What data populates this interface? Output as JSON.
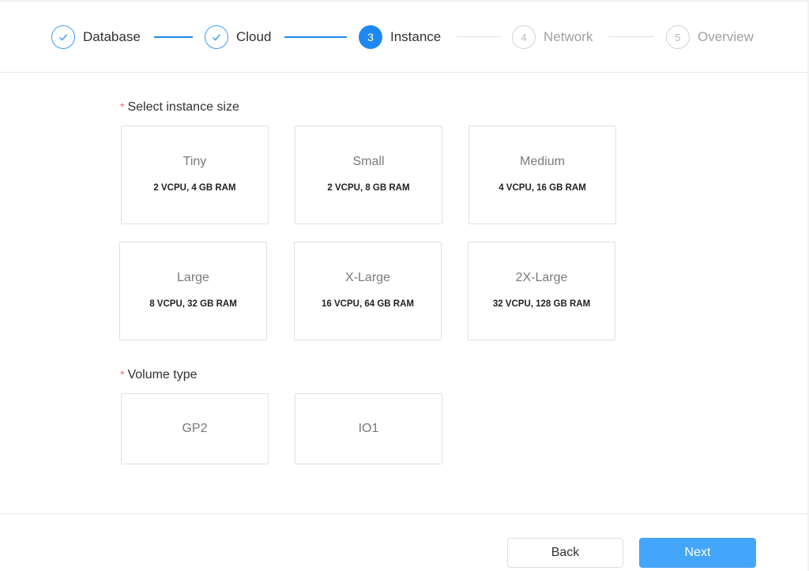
{
  "wizard": {
    "steps": [
      {
        "number": "1",
        "label": "Database",
        "status": "done",
        "icon": "check-icon"
      },
      {
        "number": "2",
        "label": "Cloud",
        "status": "done",
        "icon": "check-icon"
      },
      {
        "number": "3",
        "label": "Instance",
        "status": "active"
      },
      {
        "number": "4",
        "label": "Network",
        "status": "todo"
      },
      {
        "number": "5",
        "label": "Overview",
        "status": "todo"
      }
    ],
    "accent_color": "#1e88f0"
  },
  "instance_size": {
    "required_mark": "*",
    "label": "Select instance size",
    "options": [
      {
        "title": "Tiny",
        "spec": "2 VCPU, 4 GB RAM"
      },
      {
        "title": "Small",
        "spec": "2 VCPU, 8 GB RAM"
      },
      {
        "title": "Medium",
        "spec": "4 VCPU, 16 GB RAM"
      },
      {
        "title": "Large",
        "spec": "8 VCPU, 32 GB RAM"
      },
      {
        "title": "X-Large",
        "spec": "16 VCPU, 64 GB RAM"
      },
      {
        "title": "2X-Large",
        "spec": "32 VCPU, 128 GB RAM"
      }
    ]
  },
  "volume_type": {
    "required_mark": "*",
    "label": "Volume type",
    "options": [
      {
        "title": "GP2"
      },
      {
        "title": "IO1"
      }
    ]
  },
  "footer": {
    "back_label": "Back",
    "next_label": "Next",
    "next_color": "#44a6fb"
  }
}
